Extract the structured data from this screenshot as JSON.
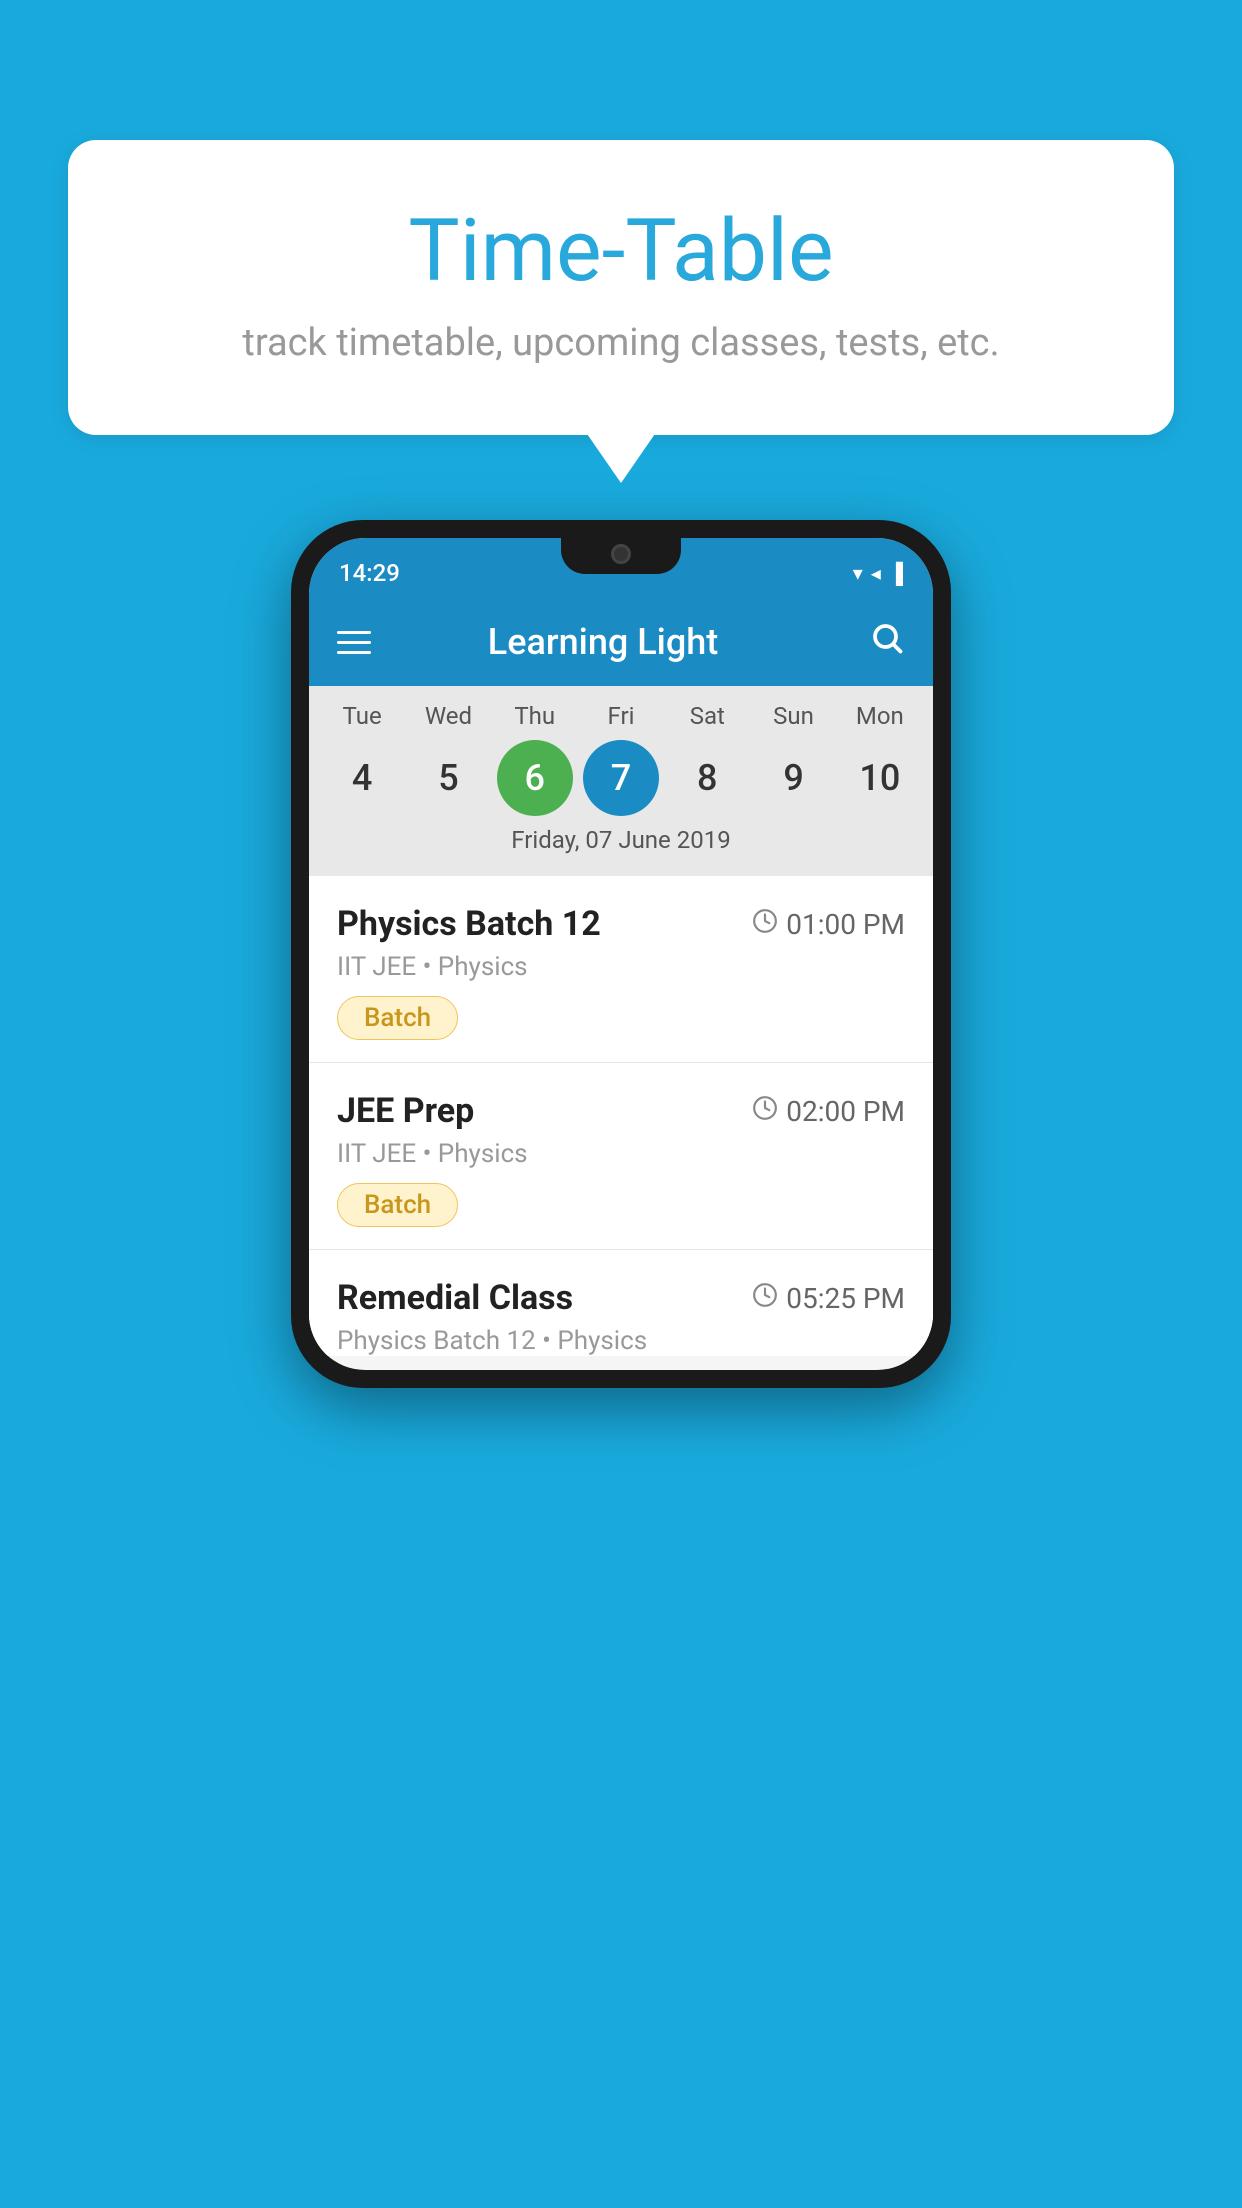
{
  "background_color": "#19AADD",
  "bubble": {
    "title": "Time-Table",
    "subtitle": "track timetable, upcoming classes, tests, etc."
  },
  "phone": {
    "status_bar": {
      "time": "14:29",
      "icons": "▼ ◄ ▐"
    },
    "app_bar": {
      "title": "Learning Light",
      "menu_icon": "menu",
      "search_icon": "search"
    },
    "calendar": {
      "days": [
        {
          "label": "Tue",
          "num": "4"
        },
        {
          "label": "Wed",
          "num": "5"
        },
        {
          "label": "Thu",
          "num": "6",
          "state": "today"
        },
        {
          "label": "Fri",
          "num": "7",
          "state": "selected"
        },
        {
          "label": "Sat",
          "num": "8"
        },
        {
          "label": "Sun",
          "num": "9"
        },
        {
          "label": "Mon",
          "num": "10"
        }
      ],
      "selected_date_label": "Friday, 07 June 2019"
    },
    "schedule": [
      {
        "title": "Physics Batch 12",
        "time": "01:00 PM",
        "subtitle": "IIT JEE • Physics",
        "badge": "Batch"
      },
      {
        "title": "JEE Prep",
        "time": "02:00 PM",
        "subtitle": "IIT JEE • Physics",
        "badge": "Batch"
      },
      {
        "title": "Remedial Class",
        "time": "05:25 PM",
        "subtitle": "Physics Batch 12 • Physics",
        "badge": null
      }
    ]
  }
}
